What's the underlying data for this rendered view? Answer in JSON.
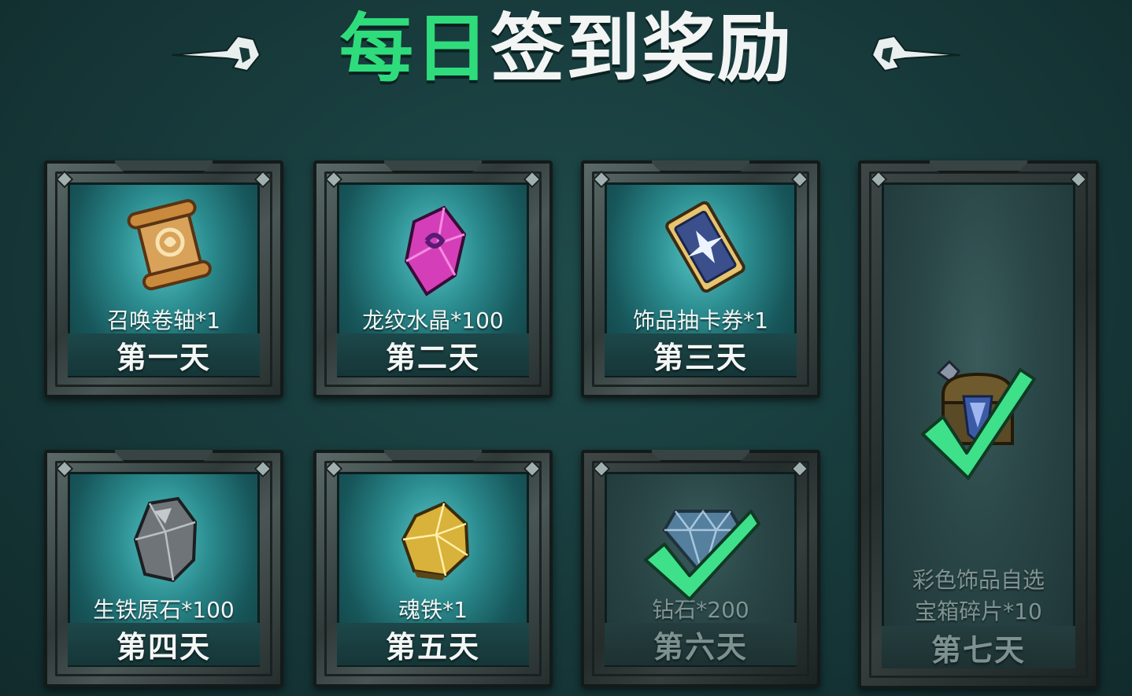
{
  "title": {
    "part1": "每日",
    "part2": "签到奖励"
  },
  "colors": {
    "title_green": "#2fdc7c",
    "check_green": "#3fe08a",
    "background": "#17393a"
  },
  "cards": [
    {
      "day": "第一天",
      "item": "召唤卷轴*1",
      "icon": "scroll-icon",
      "claimed": false
    },
    {
      "day": "第二天",
      "item": "龙纹水晶*100",
      "icon": "purple-crystal-icon",
      "claimed": false
    },
    {
      "day": "第三天",
      "item": "饰品抽卡券*1",
      "icon": "ticket-icon",
      "claimed": false
    },
    {
      "day": "第四天",
      "item": "生铁原石*100",
      "icon": "iron-ore-icon",
      "claimed": false
    },
    {
      "day": "第五天",
      "item": "魂铁*1",
      "icon": "gold-ore-icon",
      "claimed": false
    },
    {
      "day": "第六天",
      "item": "钻石*200",
      "icon": "diamond-icon",
      "claimed": true
    },
    {
      "day": "第七天",
      "item_line1": "彩色饰品自选",
      "item_line2": "宝箱碎片*10",
      "icon": "treasure-chest-icon",
      "claimed": true
    }
  ]
}
